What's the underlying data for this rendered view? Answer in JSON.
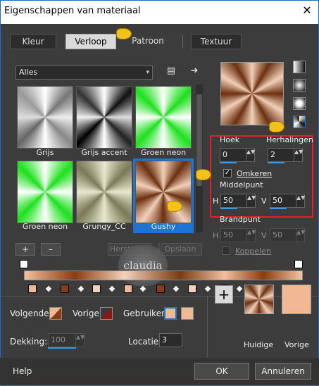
{
  "window": {
    "title": "Eigenschappen van materiaal",
    "close_glyph": "✕"
  },
  "tabs": [
    {
      "label": "Kleur"
    },
    {
      "label": "Verloop",
      "active": true
    },
    {
      "label": "Patroon"
    },
    {
      "label": "Textuur"
    }
  ],
  "library": {
    "selected": "Alles",
    "caret": "▾"
  },
  "icons": {
    "catalog_glyph": "▤",
    "arrow_glyph": "➜",
    "plus_glyph": "+",
    "minus_glyph": "–",
    "checkmark_glyph": "✓",
    "spin_glyph": "▲▼"
  },
  "gradients": [
    {
      "label": "Grijs"
    },
    {
      "label": "Grijs accent"
    },
    {
      "label": "Groen neon"
    },
    {
      "label": "Groen neon"
    },
    {
      "label": "Grungy_CC"
    },
    {
      "label": "Gushy",
      "selected": true
    }
  ],
  "buttons": {
    "add": "+",
    "remove": "–",
    "reverse": "Herstellen",
    "delete": "Opslaan",
    "ok": "OK",
    "cancel": "Annuleren",
    "help": "Help"
  },
  "angle": {
    "label": "Hoek",
    "value": "0"
  },
  "repeats": {
    "label": "Herhalingen",
    "value": "2"
  },
  "invert": {
    "label": "Omkeren",
    "checked": true
  },
  "center": {
    "label": "Middelpunt",
    "h_label": "H",
    "h_value": "50",
    "v_label": "V",
    "v_value": "50"
  },
  "focus": {
    "label": "Brandpunt",
    "h_label": "H",
    "h_value": "50",
    "v_label": "V",
    "v_value": "50"
  },
  "link": {
    "label": "Koppelen",
    "checked": false
  },
  "bottom": {
    "next_label": "Volgende:",
    "prev_label": "Vorige:",
    "user_label": "Gebruiker:",
    "opacity_label": "Dekking:",
    "opacity_value": "100",
    "location_label": "Locatie:",
    "location_value": "3",
    "current_label": "Huidige",
    "previous_label": "Vorige"
  },
  "watermark": {
    "text": "claudia"
  },
  "colors": {
    "accent": "#1c74d4",
    "highlight": "#e5202a",
    "swatch_light": "#f0b994",
    "swatch_dark": "#8a3c12"
  }
}
